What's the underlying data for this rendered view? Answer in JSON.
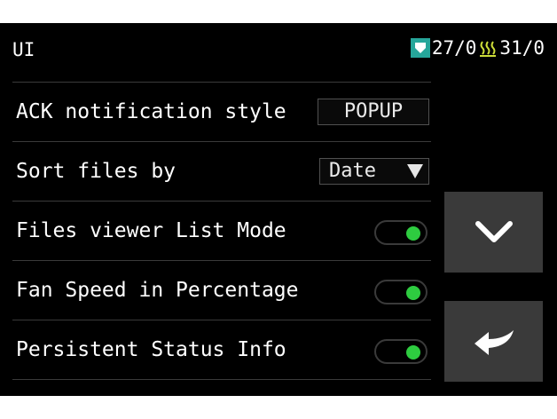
{
  "header": {
    "title": "UI",
    "bed_temp": "27/0",
    "chamber_temp": "31/0",
    "bed_icon": "bed-icon",
    "heat_icon": "heat-icon"
  },
  "settings": [
    {
      "label": "ACK notification style",
      "type": "select",
      "value": "POPUP"
    },
    {
      "label": "Sort files by",
      "type": "dropdown",
      "value": "Date"
    },
    {
      "label": "Files viewer List Mode",
      "type": "toggle",
      "enabled": true
    },
    {
      "label": "Fan Speed in Percentage",
      "type": "toggle",
      "enabled": true
    },
    {
      "label": "Persistent Status Info",
      "type": "toggle",
      "enabled": true
    }
  ],
  "buttons": {
    "down_icon": "chevron-down-icon",
    "back_icon": "back-arrow-icon"
  },
  "colors": {
    "background": "#000000",
    "toggle_on": "#2ecc40",
    "bed_icon_bg": "#26a69a",
    "heat_icon": "#cddc39",
    "button_bg": "#3a3a3a"
  }
}
